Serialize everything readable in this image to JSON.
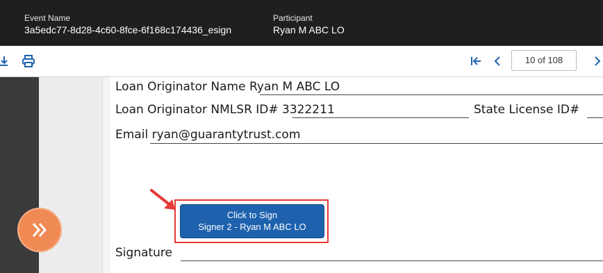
{
  "header": {
    "event_label": "Event Name",
    "event_value": "3a5edc77-8d28-4c60-8fce-6f168c174436_esign",
    "participant_label": "Participant",
    "participant_value": "Ryan M ABC LO"
  },
  "toolbar": {
    "page_indicator": "10 of 108",
    "icons": [
      "download-icon",
      "print-icon",
      "first-page-icon",
      "prev-page-icon",
      "next-page-icon"
    ],
    "accent_color": "#1e62ae"
  },
  "document": {
    "lo_name_label": "Loan Originator Name",
    "lo_name_value": "Ryan M ABC LO",
    "nmlsr_label": "Loan Originator NMLSR ID#",
    "nmlsr_value": "3322211",
    "state_license_label": "State License ID#",
    "email_label": "Email",
    "email_value": "ryan@guarantytrust.com",
    "signature_label": "Signature"
  },
  "sign_button": {
    "line1": "Click to Sign",
    "line2": "Signer 2 - Ryan M ABC LO",
    "color": "#1e62ae",
    "highlight_color": "#e53935"
  },
  "next_field_button": {
    "icon": "double-chevron-right-icon",
    "color": "#f08a55"
  }
}
